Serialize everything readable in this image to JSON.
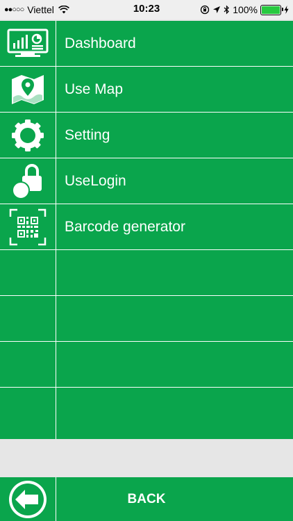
{
  "status_bar": {
    "signal": "●●○○○",
    "carrier": "Viettel",
    "time": "10:23",
    "battery": "100%"
  },
  "menu": {
    "items": [
      {
        "label": "Dashboard",
        "icon": "dashboard-monitor-icon"
      },
      {
        "label": "Use Map",
        "icon": "map-pin-icon"
      },
      {
        "label": "Setting",
        "icon": "gear-icon"
      },
      {
        "label": "UseLogin",
        "icon": "lock-user-icon"
      },
      {
        "label": "Barcode generator",
        "icon": "qr-code-scan-icon"
      },
      {
        "label": ""
      },
      {
        "label": ""
      },
      {
        "label": ""
      },
      {
        "label": ""
      }
    ]
  },
  "footer": {
    "back_label": "BACK",
    "back_icon": "arrow-left-circle-icon"
  },
  "colors": {
    "primary_green": "#0aa54c",
    "divider": "#ffffff",
    "footer_gap": "#e6e6e6"
  }
}
